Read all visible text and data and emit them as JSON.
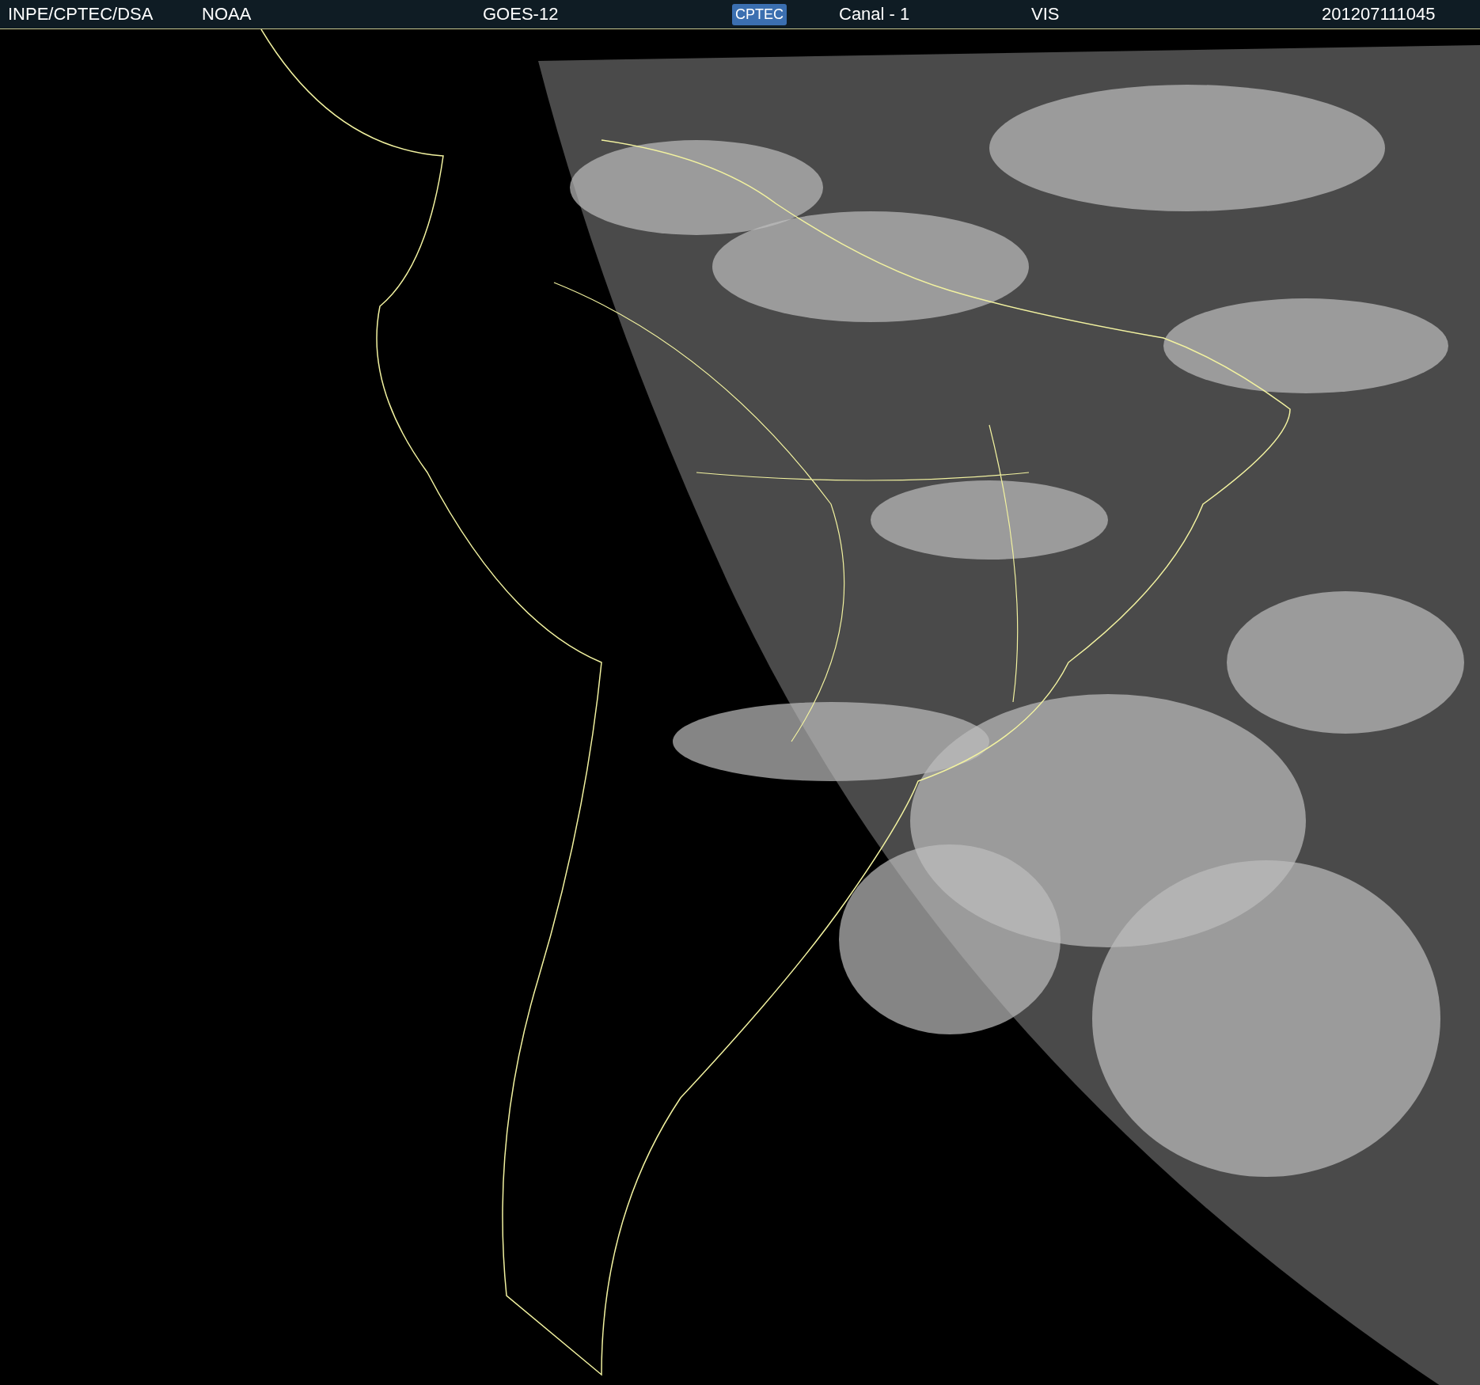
{
  "header": {
    "items": [
      {
        "kind": "text",
        "text": "INPE/CPTEC/DSA"
      },
      {
        "kind": "text",
        "text": "NOAA"
      },
      {
        "kind": "text",
        "text": "GOES-12"
      },
      {
        "kind": "logo",
        "text": "CPTEC"
      },
      {
        "kind": "text",
        "text": "Canal - 1"
      },
      {
        "kind": "text",
        "text": "VIS"
      },
      {
        "kind": "text",
        "text": "201207111045"
      }
    ]
  }
}
